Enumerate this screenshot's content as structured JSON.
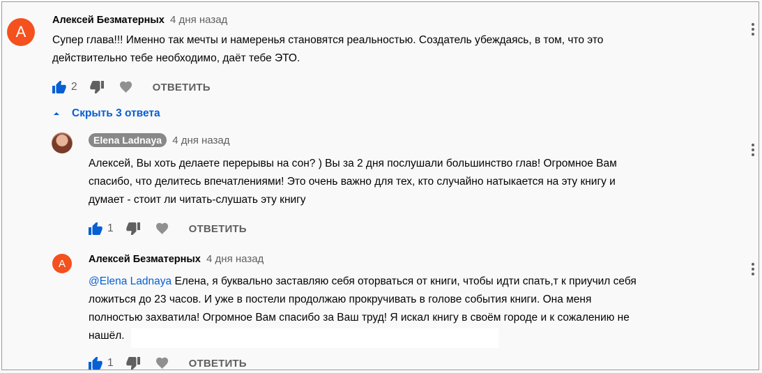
{
  "thread": {
    "top": {
      "avatar_letter": "А",
      "avatar_color": "#f4511e",
      "author": "Алексей Безматерных",
      "time": "4 дня назад",
      "text_line1": "Супер глава!!! Именно так мечты и намеренья становятся реальностью. Создатель убеждаясь, в том, что это",
      "text_line2": "действительно тебе необходимо, даёт тебе ЭТО.",
      "likes": "2",
      "reply_label": "ОТВЕТИТЬ"
    },
    "toggle_label": "Скрыть 3 ответа",
    "replies": [
      {
        "author": "Elena Ladnaya",
        "time": "4 дня назад",
        "text_line1": "Алексей, Вы хоть делаете перерывы на сон? ) Вы за 2 дня послушали большинство глав! Огромное Вам",
        "text_line2": "спасибо, что делитесь впечатлениями! Это очень важно для тех, кто случайно натыкается на эту книгу и",
        "text_line3": "думает - стоит ли читать-слушать эту книгу",
        "likes": "1",
        "reply_label": "ОТВЕТИТЬ"
      },
      {
        "avatar_letter": "А",
        "avatar_color": "#f4511e",
        "author": "Алексей Безматерных",
        "time": "4 дня назад",
        "mention": "@Elena Ladnaya",
        "text_line1_rest": " Елена, я  буквально заставляю себя оторваться от книги, чтобы идти спать,т к приучил себя",
        "text_line2": "ложиться до 23 часов. И уже в постели продолжаю прокручивать в голове события книги. Она меня",
        "text_line3": "полностью захватила! Огромное Вам спасибо за Ваш труд! Я искал книгу в своём городе и к сожалению не",
        "text_line4": "нашёл.",
        "likes": "1",
        "reply_label": "ОТВЕТИТЬ"
      }
    ]
  },
  "colors": {
    "link": "#065fd4",
    "secondary": "#606060",
    "avatar_orange": "#f4511e"
  }
}
